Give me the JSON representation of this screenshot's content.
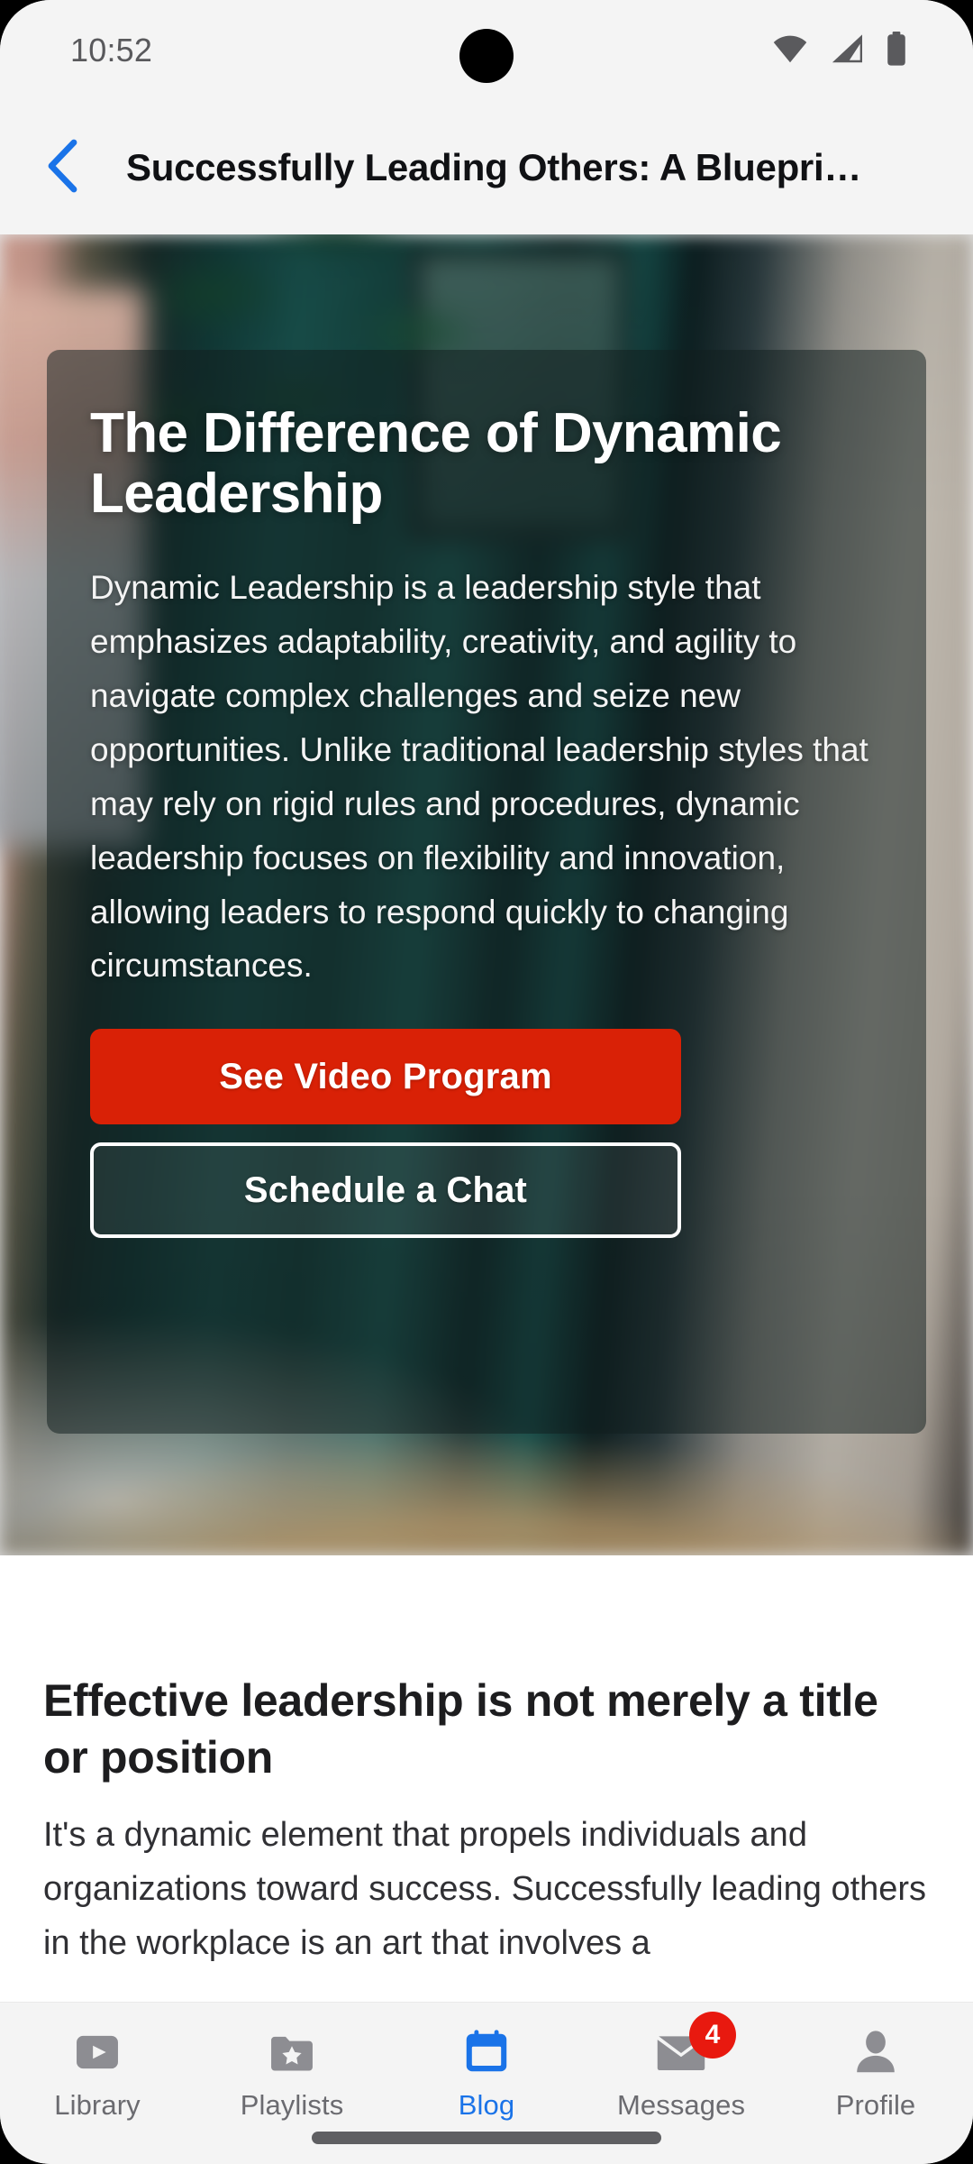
{
  "status_bar": {
    "time": "10:52",
    "icons": [
      "wifi-icon",
      "cellular-signal-icon",
      "battery-icon"
    ]
  },
  "app_bar": {
    "back_icon": "chevron-left-icon",
    "title": "Successfully Leading Others: A Bluepri…",
    "accent_color": "#1a73e8"
  },
  "hero": {
    "heading": "The Difference of Dynamic Leadership",
    "body": "Dynamic Leadership is a leadership style that emphasizes adaptability, creativity, and agility to navigate complex challenges and seize new opportunities. Unlike traditional leadership styles that may rely on rigid rules and procedures, dynamic leadership focuses on flexibility and innovation, allowing leaders to respond quickly to changing circumstances.",
    "primary_button": "See Video Program",
    "secondary_button": "Schedule a Chat",
    "primary_button_color": "#d92106"
  },
  "article": {
    "heading": "Effective leadership is not merely a title or position",
    "body": "It's a dynamic element that propels individuals and organizations toward success. Successfully leading others in the workplace is an art that involves a"
  },
  "bottom_nav": {
    "active_color": "#1a73e8",
    "inactive_color": "#6b6b70",
    "badge_color": "#e8190f",
    "items": [
      {
        "label": "Library",
        "icon": "play-square-icon",
        "active": false,
        "badge": null
      },
      {
        "label": "Playlists",
        "icon": "folder-star-icon",
        "active": false,
        "badge": null
      },
      {
        "label": "Blog",
        "icon": "calendar-icon",
        "active": true,
        "badge": null
      },
      {
        "label": "Messages",
        "icon": "envelope-icon",
        "active": false,
        "badge": "4"
      },
      {
        "label": "Profile",
        "icon": "person-icon",
        "active": false,
        "badge": null
      }
    ]
  }
}
